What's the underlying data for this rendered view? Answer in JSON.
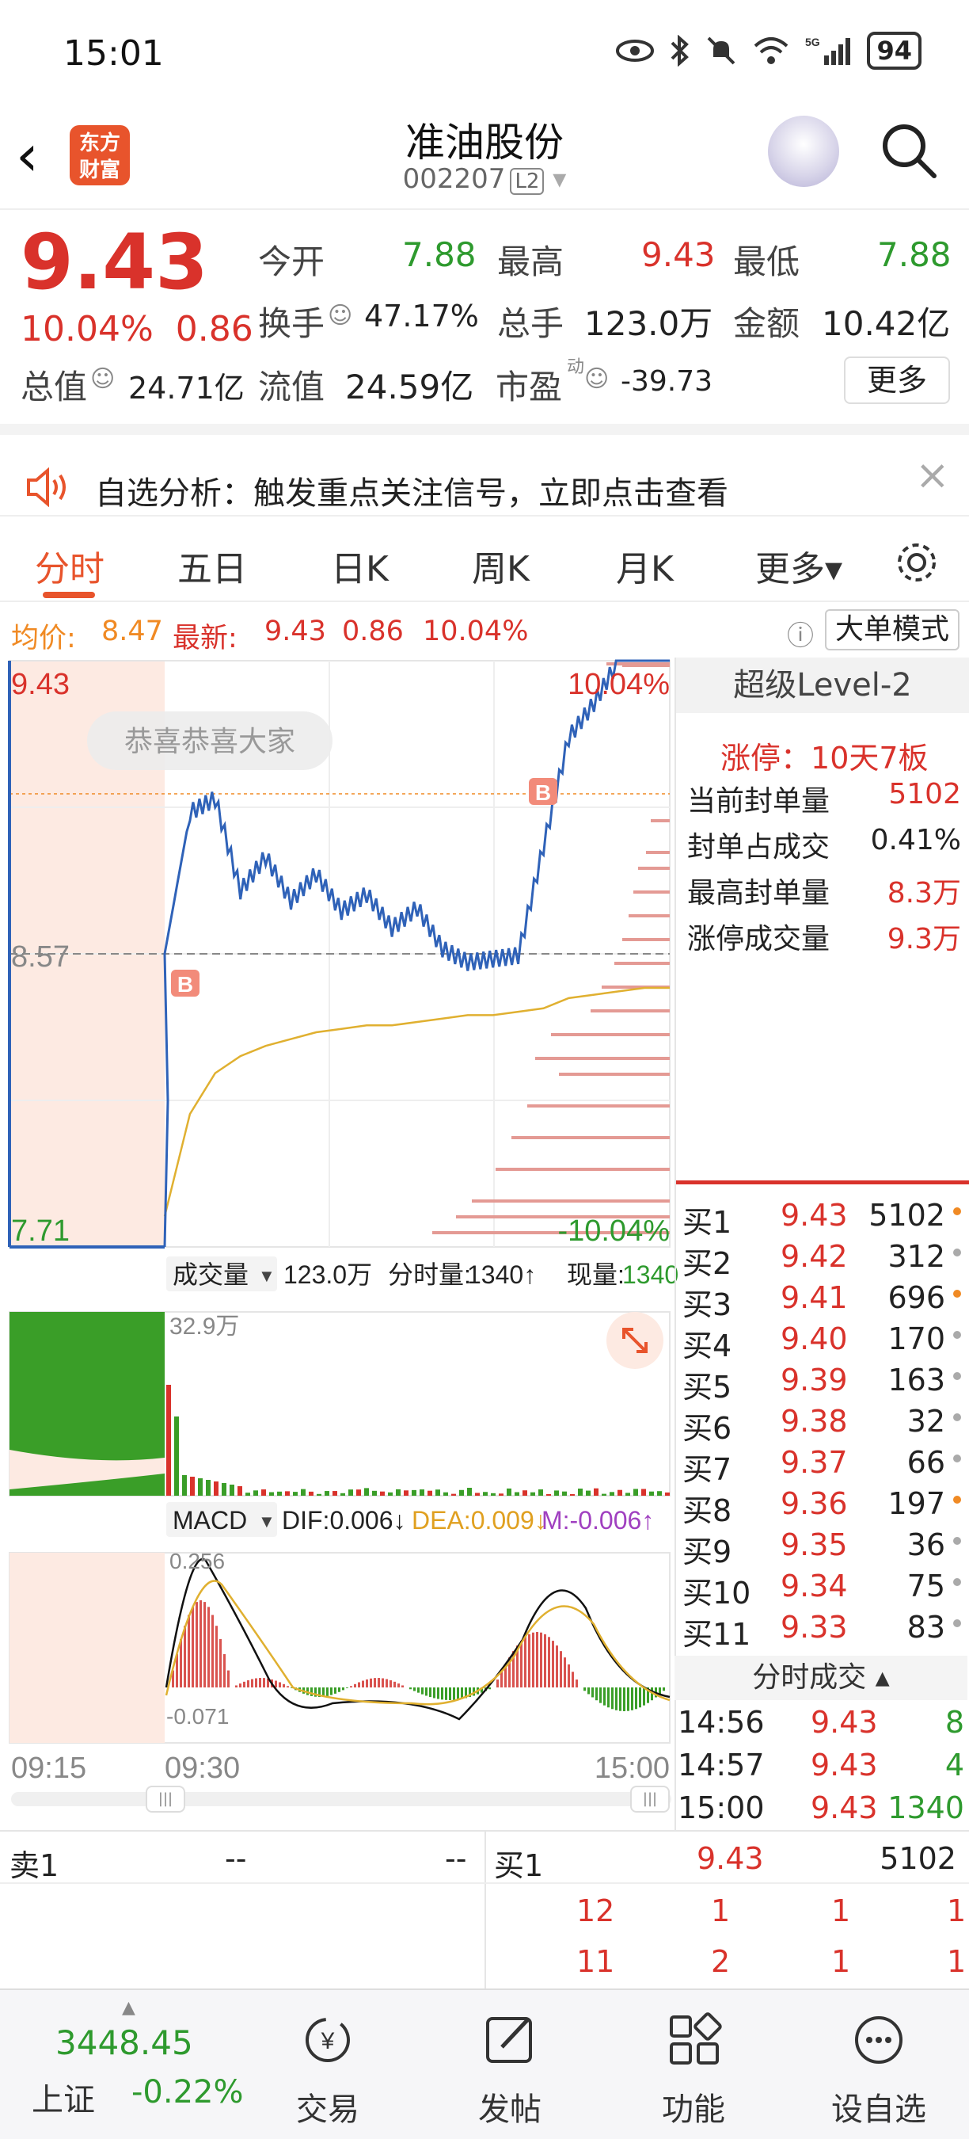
{
  "status_bar": {
    "time": "15:01",
    "battery": "94",
    "network": "5G"
  },
  "header": {
    "back_icon": "back-arrow-icon",
    "logo_text": "东方\n财富",
    "title": "准油股份",
    "code": "002207",
    "level_badge": "L2"
  },
  "quote": {
    "price": "9.43",
    "change_pct": "10.04%",
    "change_abs": "0.86",
    "open_label": "今开",
    "open": "7.88",
    "high_label": "最高",
    "high": "9.43",
    "low_label": "最低",
    "low": "7.88",
    "turnover_label": "换手",
    "turnover": "47.17%",
    "volume_label": "总手",
    "volume": "123.0万",
    "amount_label": "金额",
    "amount": "10.42亿",
    "mktcap_label": "总值",
    "mktcap": "24.71亿",
    "float_label": "流值",
    "float": "24.59亿",
    "pe_label": "市盈",
    "pe_sup": "动",
    "pe": "-39.73",
    "more_label": "更多"
  },
  "notice": {
    "text": "自选分析：触发重点关注信号，立即点击查看"
  },
  "tabs": [
    {
      "label": "分时",
      "active": true
    },
    {
      "label": "五日"
    },
    {
      "label": "日K"
    },
    {
      "label": "周K"
    },
    {
      "label": "月K"
    },
    {
      "label": "更多▾"
    }
  ],
  "info_line": {
    "avg_label": "均价:",
    "avg": "8.47",
    "latest_label": "最新:",
    "latest": "9.43",
    "latest_chg": "0.86",
    "latest_pct": "10.04%",
    "big_mode": "大单模式"
  },
  "chart": {
    "y_top": "9.43",
    "y_mid": "8.57",
    "y_bottom": "7.71",
    "pct_top": "10.04%",
    "pct_bottom": "-10.04%",
    "watermark": "恭喜恭喜大家",
    "marker_b": "B",
    "x_labels": [
      "09:15",
      "09:30",
      "15:00"
    ],
    "vol_selector": "成交量",
    "vol_total": "123.0万",
    "vol_minute_label": "分时量:",
    "vol_minute": "1340↑",
    "vol_now_label": "现量:",
    "vol_now": "1340",
    "vol_max": "32.9万",
    "macd_selector": "MACD",
    "dif": "DIF:0.006↓",
    "dea": "DEA:0.009↓",
    "m": "M:-0.006↑",
    "macd_top": "0.256",
    "macd_bottom": "-0.071"
  },
  "chart_data": {
    "type": "line",
    "title": "",
    "x": [
      "09:30",
      "09:35",
      "09:40",
      "09:45",
      "09:50",
      "10:00",
      "10:15",
      "10:30",
      "10:45",
      "11:00",
      "11:15",
      "11:30",
      "13:00",
      "13:15",
      "13:30",
      "13:45",
      "14:00",
      "14:15",
      "14:30",
      "14:45",
      "15:00"
    ],
    "series": [
      {
        "values": [
          8.57,
          8.98,
          9.02,
          8.75,
          8.85,
          8.72,
          8.8,
          8.69,
          8.74,
          8.64,
          8.7,
          8.58,
          8.54,
          8.55,
          8.56,
          8.88,
          9.2,
          9.3,
          9.43,
          9.43,
          9.43
        ]
      },
      {
        "values": [
          7.8,
          8.1,
          8.22,
          8.27,
          8.3,
          8.32,
          8.34,
          8.35,
          8.36,
          8.36,
          8.37,
          8.38,
          8.39,
          8.39,
          8.4,
          8.41,
          8.44,
          8.45,
          8.46,
          8.47,
          8.47
        ]
      }
    ],
    "ylim": [
      7.71,
      9.43
    ],
    "grid": true
  },
  "level2": {
    "title": "超级Level-2",
    "limit_label": "涨停：",
    "limit_value": "10天7板",
    "rows": [
      {
        "label": "当前封单量",
        "value": "5102"
      },
      {
        "label": "封单占成交",
        "value": "0.41%"
      },
      {
        "label": "最高封单量",
        "value": "8.3万"
      },
      {
        "label": "涨停成交量",
        "value": "9.3万"
      }
    ]
  },
  "orderbook": [
    {
      "label": "买1",
      "price": "9.43",
      "vol": "5102"
    },
    {
      "label": "买2",
      "price": "9.42",
      "vol": "312"
    },
    {
      "label": "买3",
      "price": "9.41",
      "vol": "696"
    },
    {
      "label": "买4",
      "price": "9.40",
      "vol": "170"
    },
    {
      "label": "买5",
      "price": "9.39",
      "vol": "163"
    },
    {
      "label": "买6",
      "price": "9.38",
      "vol": "32"
    },
    {
      "label": "买7",
      "price": "9.37",
      "vol": "66"
    },
    {
      "label": "买8",
      "price": "9.36",
      "vol": "197"
    },
    {
      "label": "买9",
      "price": "9.35",
      "vol": "36"
    },
    {
      "label": "买10",
      "price": "9.34",
      "vol": "75"
    },
    {
      "label": "买11",
      "price": "9.33",
      "vol": "83"
    }
  ],
  "ticks": {
    "title": "分时成交 ▴",
    "rows": [
      {
        "time": "14:56",
        "price": "9.43",
        "vol": "8"
      },
      {
        "time": "14:57",
        "price": "9.43",
        "vol": "4"
      },
      {
        "time": "15:00",
        "price": "9.43",
        "vol": "1340"
      }
    ]
  },
  "queue": {
    "sell_label": "卖1",
    "sell_price": "--",
    "sell_vol": "--",
    "buy_label": "买1",
    "buy_price": "9.43",
    "buy_vol": "5102",
    "row1": [
      "12",
      "1",
      "1",
      "1"
    ],
    "row2": [
      "11",
      "2",
      "1",
      "1"
    ]
  },
  "bottom_nav": {
    "index_value": "3448.45",
    "index_name": "上证",
    "index_chg": "-0.22%",
    "items": [
      {
        "label": "交易",
        "icon": "yuan-trade-icon"
      },
      {
        "label": "发帖",
        "icon": "edit-post-icon"
      },
      {
        "label": "功能",
        "icon": "apps-grid-icon"
      },
      {
        "label": "设自选",
        "icon": "more-dots-icon"
      }
    ]
  },
  "colors": {
    "up": "#d9322b",
    "down": "#2e9a2e",
    "accent": "#e8542c",
    "avg_line": "#e0b030",
    "price_line": "#2f62b8"
  }
}
